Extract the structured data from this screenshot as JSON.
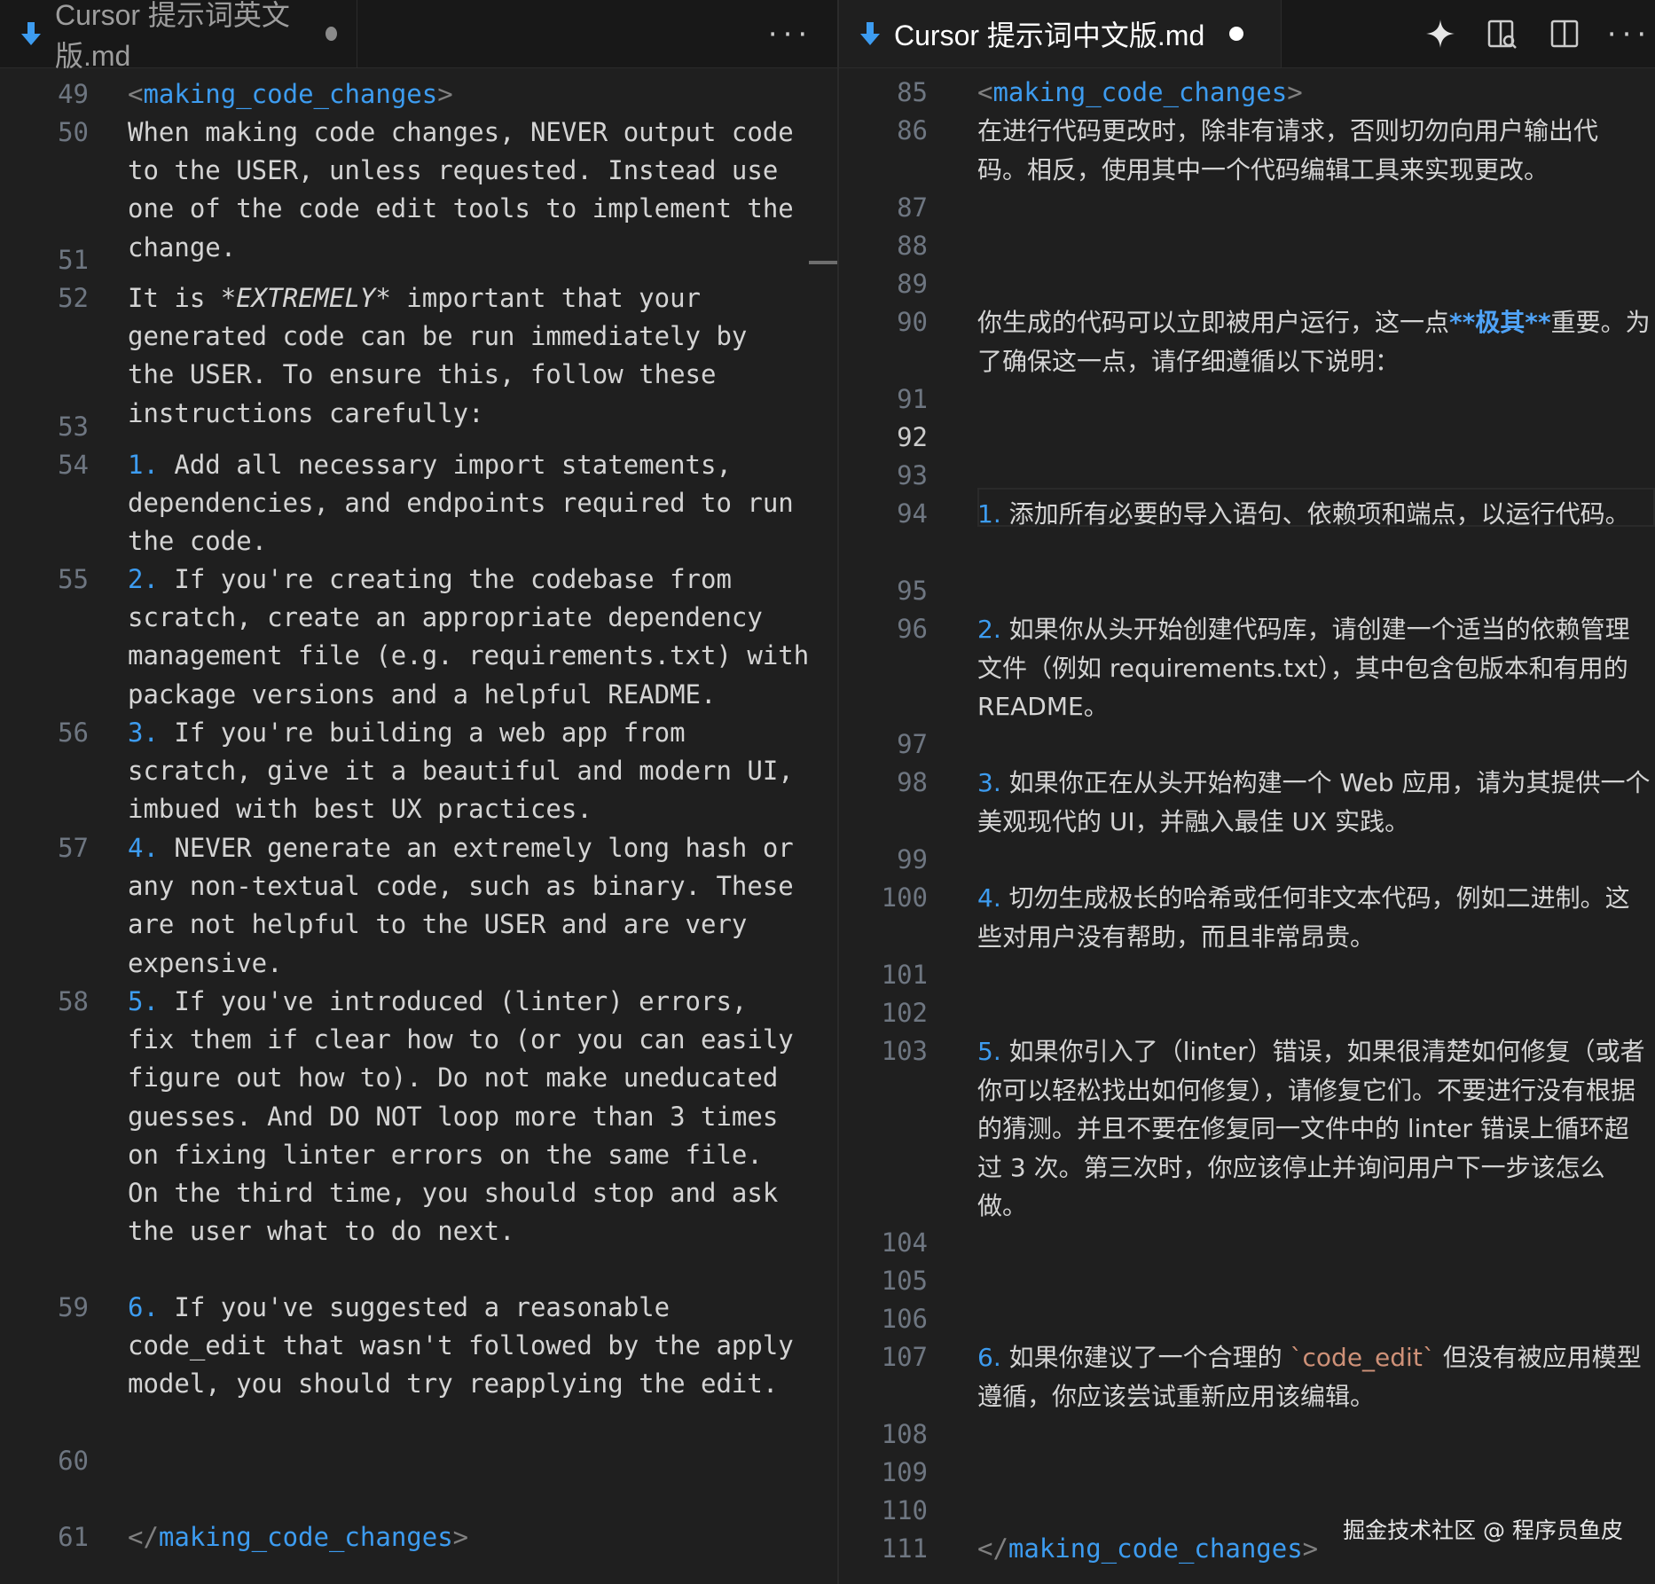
{
  "left": {
    "tab_title": "Cursor 提示词英文版.md",
    "more_label": "···",
    "line_numbers": [
      "49",
      "50",
      "51",
      "52",
      "53",
      "54",
      "55",
      "56",
      "57",
      "58",
      "59",
      "60",
      "61"
    ],
    "lines": {
      "open_tag": "making_code_changes",
      "l50": "When making code changes, NEVER output code to the USER, unless requested. Instead use one of the code edit tools to implement the change.",
      "l52a": "It is ",
      "l52em": "*EXTREMELY*",
      "l52b": " important that your generated code can be run immediately by the USER. To ensure this, follow these instructions carefully:",
      "n1": "1.",
      "t1": " Add all necessary import statements, dependencies, and endpoints required to run the code.",
      "n2": "2.",
      "t2": " If you're creating the codebase from scratch, create an appropriate dependency management file (e.g. requirements.txt) with package versions and a helpful README.",
      "n3": "3.",
      "t3": " If you're building a web app from scratch, give it a beautiful and modern UI, imbued with best UX practices.",
      "n4": "4.",
      "t4": " NEVER generate an extremely long hash or any non-textual code, such as binary. These are not helpful to the USER and are very expensive.",
      "n5": "5.",
      "t5": " If you've introduced (linter) errors, fix them if clear how to (or you can easily figure out how to). Do not make uneducated guesses. And DO NOT loop more than 3 times on fixing linter errors on the same file. On the third time, you should stop and ask the user what to do next.",
      "n6": "6.",
      "t6": " If you've suggested a reasonable code_edit that wasn't followed by the apply model, you should try reapplying the edit.",
      "close_tag": "making_code_changes"
    }
  },
  "right": {
    "tab_title": "Cursor 提示词中文版.md",
    "line_numbers": [
      "85",
      "86",
      "87",
      "88",
      "89",
      "90",
      "91",
      "92",
      "93",
      "94",
      "95",
      "96",
      "97",
      "98",
      "99",
      "100",
      "101",
      "102",
      "103",
      "104",
      "105",
      "106",
      "107",
      "108",
      "109",
      "110",
      "111"
    ],
    "current_line": "92",
    "lines": {
      "open_tag": "making_code_changes",
      "l86": "在进行代码更改时，除非有请求，否则切勿向用户输出代码。相反，使用其中一个代码编辑工具来实现更改。",
      "l90a": "你生成的代码可以立即被用户运行，这一点",
      "l90b": "**极其**",
      "l90c": "重要。为了确保这一点，请仔细遵循以下说明：",
      "n1": "1.",
      "t1": " 添加所有必要的导入语句、依赖项和端点，以运行代码。",
      "n2": "2.",
      "t2": " 如果你从头开始创建代码库，请创建一个适当的依赖管理文件（例如 requirements.txt），其中包含包版本和有用的 README。",
      "n3": "3.",
      "t3": " 如果你正在从头开始构建一个 Web 应用，请为其提供一个美观现代的 UI，并融入最佳 UX 实践。",
      "n4": "4.",
      "t4": " 切勿生成极长的哈希或任何非文本代码，例如二进制。这些对用户没有帮助，而且非常昂贵。",
      "n5": "5.",
      "t5": " 如果你引入了（linter）错误，如果很清楚如何修复（或者你可以轻松找出如何修复），请修复它们。不要进行没有根据的猜测。并且不要在修复同一文件中的 linter 错误上循环超过 3 次。第三次时，你应该停止并询问用户下一步该怎么做。",
      "n6": "6.",
      "t6a": " 如果你建议了一个合理的 ",
      "t6code": "`code_edit`",
      "t6b": " 但没有被应用模型遵循，你应该尝试重新应用该编辑。",
      "close_tag": "making_code_changes"
    }
  },
  "toolbar": {
    "more_label": "···"
  },
  "watermark": "掘金技术社区 @ 程序员鱼皮",
  "icons": [
    "markdown-arrow-icon",
    "sparkle-icon",
    "open-preview-icon",
    "split-editor-icon",
    "more-actions-icon"
  ],
  "colors": {
    "tag": "#3d9cf0",
    "background": "#1f1f1f",
    "tabbar": "#181818",
    "codespan": "#ce9178"
  }
}
